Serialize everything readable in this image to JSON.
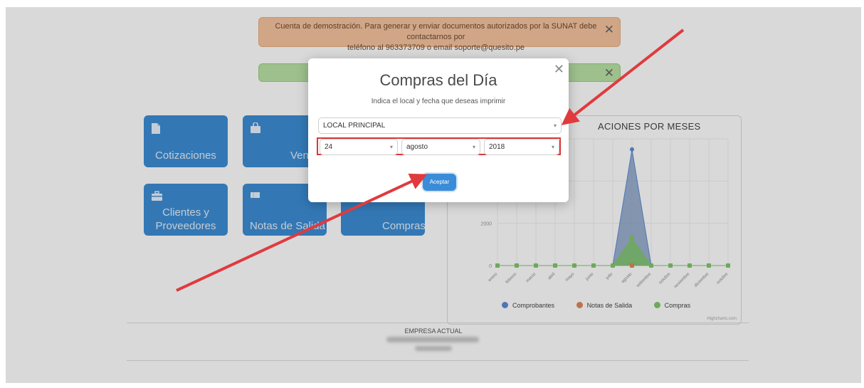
{
  "alerts": {
    "demo_line1": "Cuenta de demostración. Para generar y enviar documentos autorizados por la SUNAT debe contactarnos por",
    "demo_line2": "teléfono al 963373709 o email soporte@quesito.pe",
    "close_glyph": "✕"
  },
  "tiles": {
    "cotizaciones": "Cotizaciones",
    "ventas": "Vent",
    "clientes_line1": "Clientes y",
    "clientes_line2": "Proveedores",
    "notas": "Notas de Salida",
    "compras": "Compras"
  },
  "chart_data": {
    "type": "area",
    "title": "ACIONES POR MESES",
    "categories": [
      "enero",
      "febrero",
      "marzo",
      "abril",
      "mayo",
      "junio",
      "julio",
      "agosto",
      "setiembre",
      "octubre",
      "noviembre",
      "diciembre",
      "octubre"
    ],
    "yticks": [
      "0",
      "2000"
    ],
    "series": [
      {
        "name": "Comprobantes",
        "color": "#5b8ed6",
        "values": [
          0,
          0,
          0,
          0,
          0,
          0,
          0,
          5500,
          0,
          0,
          0,
          0,
          0
        ]
      },
      {
        "name": "Notas de Salida",
        "color": "#e0875a",
        "values": [
          0,
          0,
          0,
          0,
          0,
          0,
          0,
          0,
          0,
          0,
          0,
          0,
          0
        ]
      },
      {
        "name": "Compras",
        "color": "#80c86c",
        "values": [
          0,
          0,
          0,
          0,
          0,
          0,
          0,
          1300,
          0,
          0,
          0,
          0,
          0
        ]
      }
    ],
    "ylim": [
      0,
      6000
    ]
  },
  "footer": {
    "company_title": "EMPRESA ACTUAL"
  },
  "modal": {
    "title": "Compras del Día",
    "subtitle": "Indica el local y fecha que deseas imprimir",
    "local_value": "LOCAL PRINCIPAL",
    "day_value": "24",
    "month_value": "agosto",
    "year_value": "2018",
    "accept_label": "Aceptar",
    "close_glyph": "✕",
    "dropdown_glyph": "▾"
  },
  "colors": {
    "tile_blue": "#3d8ed5",
    "highlight_red": "#d8383a",
    "arrow_red": "#e03a3e",
    "accept_blue": "#3b8cd8"
  }
}
